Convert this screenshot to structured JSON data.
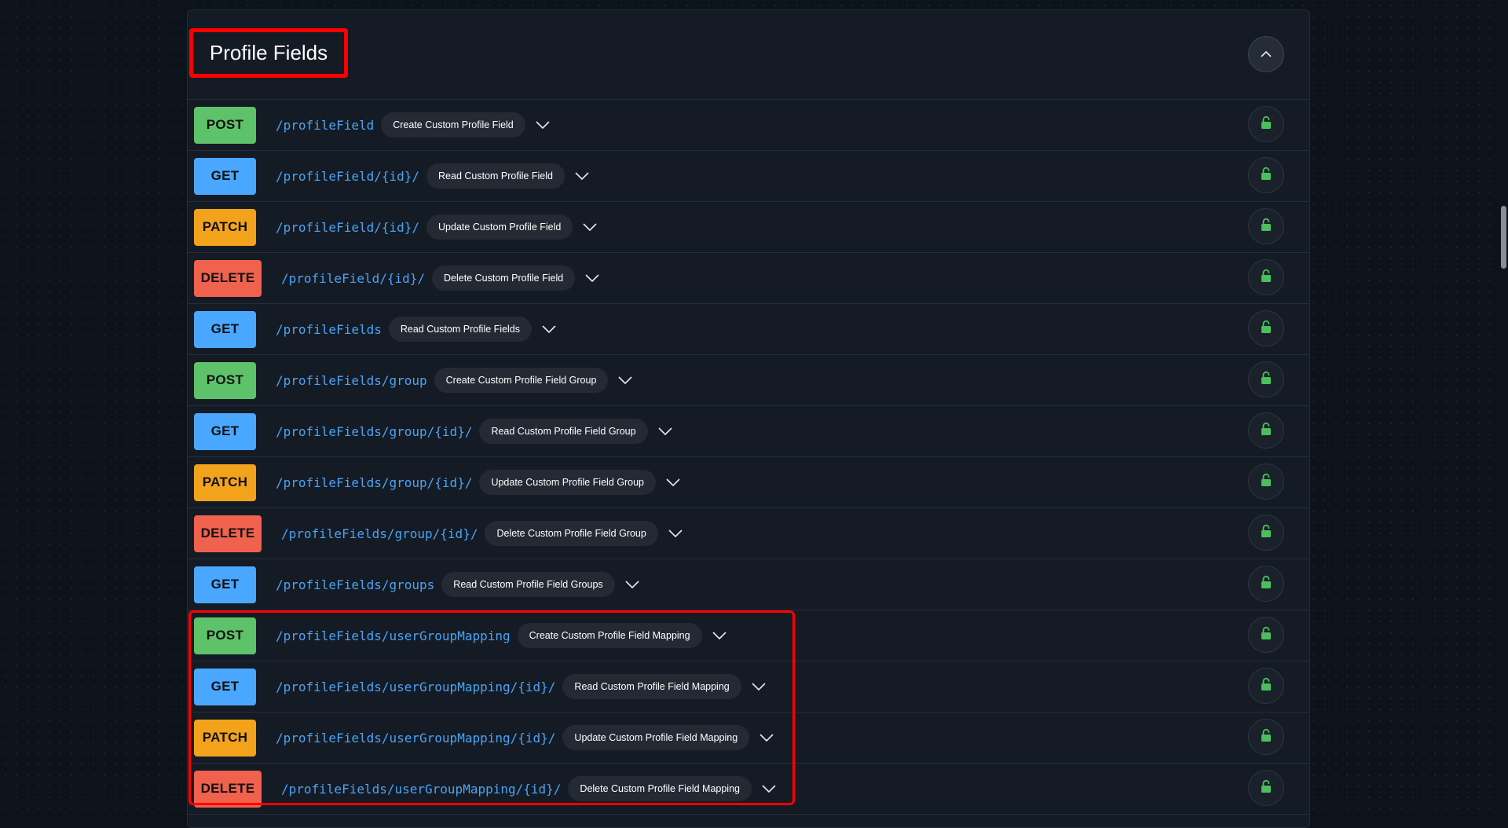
{
  "section": {
    "title": "Profile Fields",
    "collapse_icon": "chevron-up-icon",
    "endpoint_icons": {
      "expand": "chevron-down-icon",
      "auth": "lock-icon"
    }
  },
  "colors": {
    "POST": "#5ec26a",
    "GET": "#4aa7ff",
    "PATCH": "#f2a31b",
    "DELETE": "#f0614e",
    "path": "#4aa3f5",
    "lock": "#4bbf5c",
    "highlight": "#ff0000"
  },
  "endpoints": [
    {
      "method": "POST",
      "path": "/profileField",
      "summary": "Create Custom Profile Field"
    },
    {
      "method": "GET",
      "path": "/profileField/{id}/",
      "summary": "Read Custom Profile Field"
    },
    {
      "method": "PATCH",
      "path": "/profileField/{id}/",
      "summary": "Update Custom Profile Field"
    },
    {
      "method": "DELETE",
      "path": "/profileField/{id}/",
      "summary": "Delete Custom Profile Field"
    },
    {
      "method": "GET",
      "path": "/profileFields",
      "summary": "Read Custom Profile Fields"
    },
    {
      "method": "POST",
      "path": "/profileFields/group",
      "summary": "Create Custom Profile Field Group"
    },
    {
      "method": "GET",
      "path": "/profileFields/group/{id}/",
      "summary": "Read Custom Profile Field Group"
    },
    {
      "method": "PATCH",
      "path": "/profileFields/group/{id}/",
      "summary": "Update Custom Profile Field Group"
    },
    {
      "method": "DELETE",
      "path": "/profileFields/group/{id}/",
      "summary": "Delete Custom Profile Field Group"
    },
    {
      "method": "GET",
      "path": "/profileFields/groups",
      "summary": "Read Custom Profile Field Groups"
    },
    {
      "method": "POST",
      "path": "/profileFields/userGroupMapping",
      "summary": "Create Custom Profile Field Mapping"
    },
    {
      "method": "GET",
      "path": "/profileFields/userGroupMapping/{id}/",
      "summary": "Read Custom Profile Field Mapping"
    },
    {
      "method": "PATCH",
      "path": "/profileFields/userGroupMapping/{id}/",
      "summary": "Update Custom Profile Field Mapping"
    },
    {
      "method": "DELETE",
      "path": "/profileFields/userGroupMapping/{id}/",
      "summary": "Delete Custom Profile Field Mapping"
    }
  ]
}
